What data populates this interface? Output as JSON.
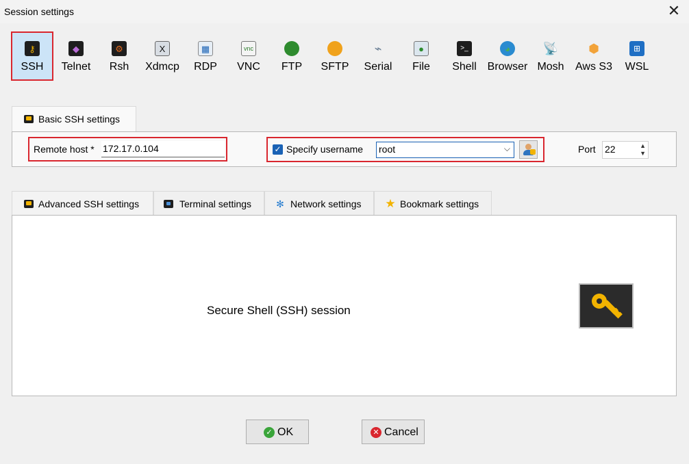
{
  "window": {
    "title": "Session settings"
  },
  "session_types": [
    {
      "label": "SSH",
      "icon": "key-icon",
      "selected": true
    },
    {
      "label": "Telnet",
      "icon": "telnet-icon"
    },
    {
      "label": "Rsh",
      "icon": "rsh-icon"
    },
    {
      "label": "Xdmcp",
      "icon": "xdmcp-icon"
    },
    {
      "label": "RDP",
      "icon": "rdp-icon"
    },
    {
      "label": "VNC",
      "icon": "vnc-icon"
    },
    {
      "label": "FTP",
      "icon": "ftp-icon"
    },
    {
      "label": "SFTP",
      "icon": "sftp-icon"
    },
    {
      "label": "Serial",
      "icon": "serial-icon"
    },
    {
      "label": "File",
      "icon": "file-icon"
    },
    {
      "label": "Shell",
      "icon": "shell-icon"
    },
    {
      "label": "Browser",
      "icon": "browser-icon"
    },
    {
      "label": "Mosh",
      "icon": "mosh-icon"
    },
    {
      "label": "Aws S3",
      "icon": "aws-s3-icon"
    },
    {
      "label": "WSL",
      "icon": "wsl-icon"
    }
  ],
  "basic": {
    "tab_label": "Basic SSH settings",
    "remote_host_label": "Remote host *",
    "remote_host_value": "172.17.0.104",
    "specify_username_label": "Specify username",
    "specify_username_checked": true,
    "username_value": "root",
    "port_label": "Port",
    "port_value": "22"
  },
  "tabs": [
    {
      "label": "Advanced SSH settings",
      "icon": "key-icon"
    },
    {
      "label": "Terminal settings",
      "icon": "terminal-icon"
    },
    {
      "label": "Network settings",
      "icon": "network-icon"
    },
    {
      "label": "Bookmark settings",
      "icon": "star-icon"
    }
  ],
  "description": "Secure Shell (SSH) session",
  "buttons": {
    "ok": "OK",
    "cancel": "Cancel"
  },
  "colors": {
    "highlight": "#d9262e",
    "selected_bg": "#cce4f7",
    "accent": "#1a62b5"
  }
}
